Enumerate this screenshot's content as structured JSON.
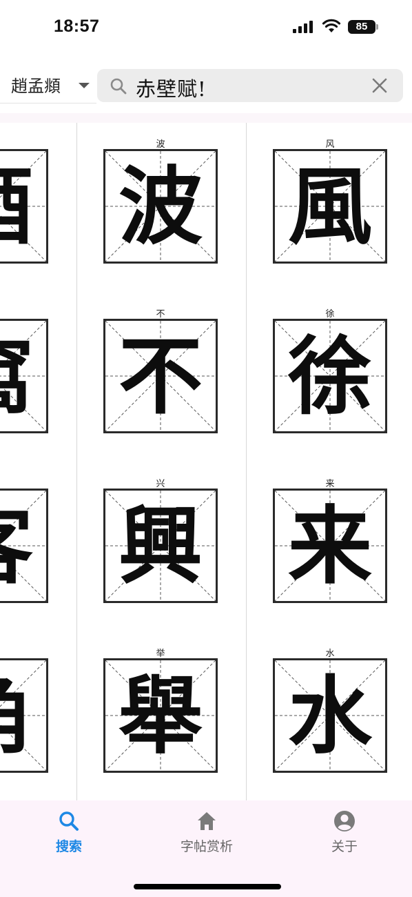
{
  "status_bar": {
    "time": "18:57",
    "battery_level": "85"
  },
  "header": {
    "font_selector": {
      "value": "趙孟頫",
      "icon": "chevron-down-icon"
    },
    "search": {
      "value": "赤壁赋!",
      "icons": [
        "search-icon",
        "clear-icon"
      ]
    }
  },
  "grid": {
    "columns": [
      {
        "cells": [
          {
            "label": "",
            "glyph": "酒"
          },
          {
            "label": "",
            "glyph": "窩"
          },
          {
            "label": "",
            "glyph": "客"
          },
          {
            "label": "",
            "glyph": "角"
          }
        ]
      },
      {
        "cells": [
          {
            "label": "波",
            "glyph": "波"
          },
          {
            "label": "不",
            "glyph": "不"
          },
          {
            "label": "兴",
            "glyph": "興"
          },
          {
            "label": "举",
            "glyph": "舉"
          }
        ]
      },
      {
        "cells": [
          {
            "label": "风",
            "glyph": "風"
          },
          {
            "label": "徐",
            "glyph": "徐"
          },
          {
            "label": "来",
            "glyph": "来"
          },
          {
            "label": "水",
            "glyph": "水"
          }
        ]
      }
    ]
  },
  "tabbar": {
    "tabs": [
      {
        "label": "搜索",
        "icon": "search-icon",
        "active": true
      },
      {
        "label": "字帖赏析",
        "icon": "home-icon",
        "active": false
      },
      {
        "label": "关于",
        "icon": "user-icon",
        "active": false
      }
    ]
  },
  "colors": {
    "accent": "#1e88e5",
    "tab_inactive": "#666666",
    "tabbar_bg": "#fdf3fb",
    "search_bg": "#ececec"
  }
}
